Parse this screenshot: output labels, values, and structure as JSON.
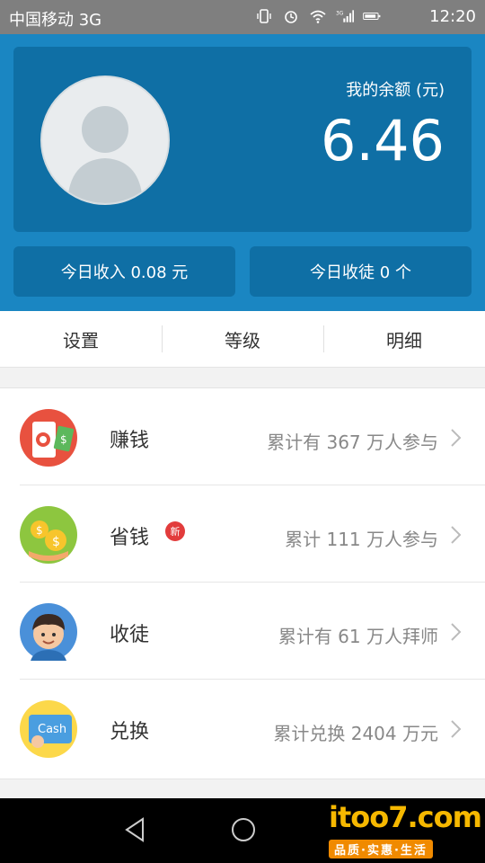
{
  "status_bar": {
    "carrier": "中国移动 3G",
    "time": "12:20",
    "network": "3G"
  },
  "account": {
    "balance_label": "我的余额 (元)",
    "balance": "6.46",
    "today_income": "今日收入 0.08 元",
    "today_apprentices": "今日收徒 0 个"
  },
  "tabs": [
    {
      "label": "设置"
    },
    {
      "label": "等级"
    },
    {
      "label": "明细"
    }
  ],
  "list": [
    {
      "title": "赚钱",
      "desc": "累计有 367 万人参与",
      "icon": "phone-money-icon"
    },
    {
      "title": "省钱",
      "desc": "累计 111 万人参与",
      "icon": "coins-icon",
      "badge": "新"
    },
    {
      "title": "收徒",
      "desc": "累计有 61 万人拜师",
      "icon": "boy-avatar-icon"
    },
    {
      "title": "兑换",
      "desc": "累计兑换 2404 万元",
      "icon": "cash-card-icon"
    }
  ],
  "watermark": {
    "brand": "itoo7.com",
    "slogan": "品质·实惠·生活"
  },
  "colors": {
    "primary": "#1a86c2",
    "card": "#0f6fa5",
    "badge": "#e23c3c"
  }
}
